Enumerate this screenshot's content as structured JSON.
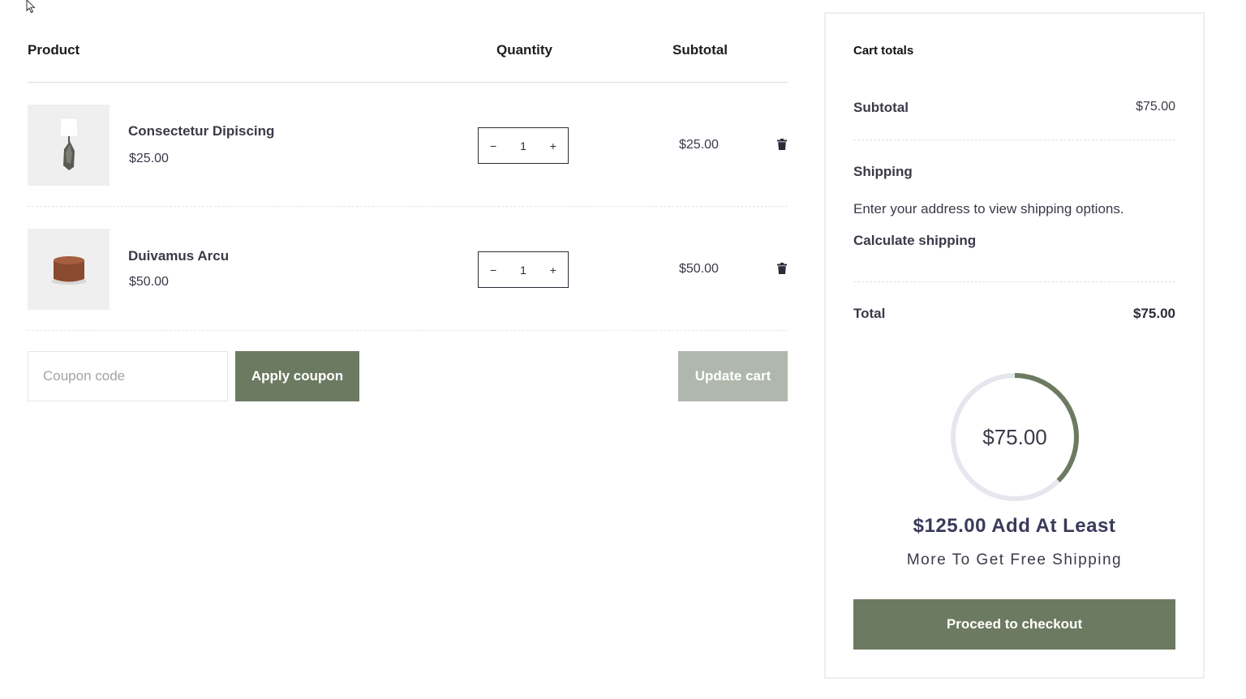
{
  "table": {
    "headers": {
      "product": "Product",
      "quantity": "Quantity",
      "subtotal": "Subtotal"
    },
    "items": [
      {
        "name": "Consectetur Dipiscing",
        "price": "$25.00",
        "quantity": "1",
        "subtotal": "$25.00",
        "image": "lamp"
      },
      {
        "name": "Duivamus Arcu",
        "price": "$50.00",
        "quantity": "1",
        "subtotal": "$50.00",
        "image": "pouf"
      }
    ],
    "qty_minus": "−",
    "qty_plus": "+"
  },
  "coupon": {
    "placeholder": "Coupon code",
    "apply_label": "Apply coupon",
    "update_label": "Update cart"
  },
  "totals": {
    "title": "Cart totals",
    "subtotal_label": "Subtotal",
    "subtotal_value": "$75.00",
    "shipping_label": "Shipping",
    "shipping_info": "Enter your address to view shipping options.",
    "calculate_label": "Calculate shipping",
    "total_label": "Total",
    "total_value": "$75.00",
    "progress_value": "$75.00",
    "progress_fraction": 0.375,
    "free_ship_line1": "$125.00 Add At Least",
    "free_ship_line2": "More To Get Free Shipping",
    "checkout_label": "Proceed to checkout"
  },
  "colors": {
    "accent": "#6c7a61",
    "accent_light": "#b0b8ad",
    "ring_track": "#e6e6ee"
  },
  "icons": {
    "remove": "trash-icon",
    "cursor": "mouse-pointer-icon"
  }
}
